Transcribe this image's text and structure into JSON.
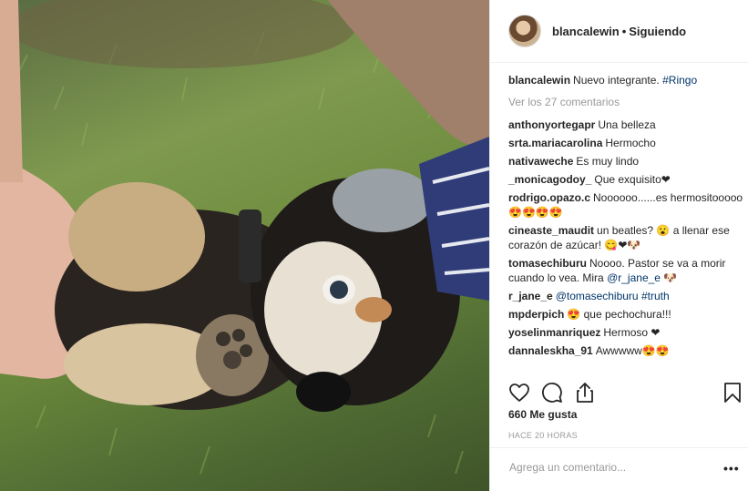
{
  "header": {
    "username": "blancalewin",
    "separator": "•",
    "follow_state": "Siguiendo"
  },
  "caption": {
    "username": "blancalewin",
    "text": "Nuevo integrante.",
    "hashtag": "#Ringo"
  },
  "view_comments": "Ver los 27 comentarios",
  "comments": [
    {
      "user": "anthonyortegapr",
      "text": "Una belleza"
    },
    {
      "user": "srta.mariacarolina",
      "text": "Hermocho"
    },
    {
      "user": "nativaweche",
      "text": "Es muy lindo"
    },
    {
      "user": "_monicagodoy_",
      "text": "Que exquisito❤"
    },
    {
      "user": "rodrigo.opazo.c",
      "text": "Noooooo......es hermositooooo😍😍😍😍"
    },
    {
      "user": "cineaste_maudit",
      "text": "un beatles? 😮 a llenar ese corazón de azúcar! 😋❤🐶"
    },
    {
      "user": "tomasechiburu",
      "text": "Noooo. Pastor se va a morir cuando lo vea. Mira",
      "mention": "@r_jane_e",
      "extra": " 🐶"
    },
    {
      "user": "r_jane_e",
      "text": "",
      "mention": "@tomasechiburu",
      "hashtag": "#truth"
    },
    {
      "user": "mpderpich",
      "text": "😍 que pechochura!!!"
    },
    {
      "user": "yoselinmanriquez",
      "text": "Hermoso ❤"
    },
    {
      "user": "dannaleskha_91",
      "text": "Awwwww😍😍"
    }
  ],
  "actions": {
    "like_icon": "heart-icon",
    "comment_icon": "comment-icon",
    "share_icon": "share-icon",
    "save_icon": "bookmark-icon"
  },
  "likes": "660 Me gusta",
  "timestamp": "HACE 20 HORAS",
  "add_comment": {
    "placeholder": "Agrega un comentario...",
    "more": "•••"
  },
  "photo": {
    "subject": "puppy-photo"
  }
}
